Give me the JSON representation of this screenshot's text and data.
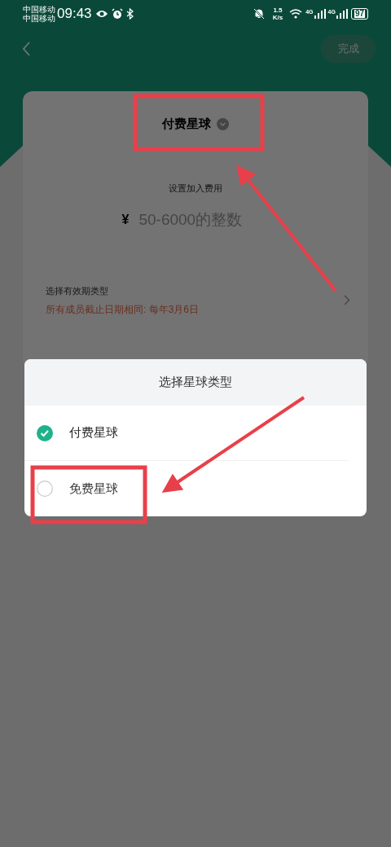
{
  "status_bar": {
    "carriers": [
      "中国移动",
      "中国移动"
    ],
    "time": "09:43",
    "speed_value": "1.5",
    "speed_unit": "K/s",
    "network_labels": [
      "4G",
      "4G"
    ],
    "battery": "97"
  },
  "nav": {
    "done_button": "完成"
  },
  "card": {
    "type_title": "付费星球",
    "fee_label": "设置加入费用",
    "currency": "¥",
    "fee_placeholder": "50-6000的整数",
    "validity_label": "选择有效期类型",
    "validity_value": "所有成员截止日期相同: 每年3月6日"
  },
  "sheet": {
    "title": "选择星球类型",
    "options": [
      {
        "label": "付费星球",
        "selected": true
      },
      {
        "label": "免费星球",
        "selected": false
      }
    ]
  }
}
